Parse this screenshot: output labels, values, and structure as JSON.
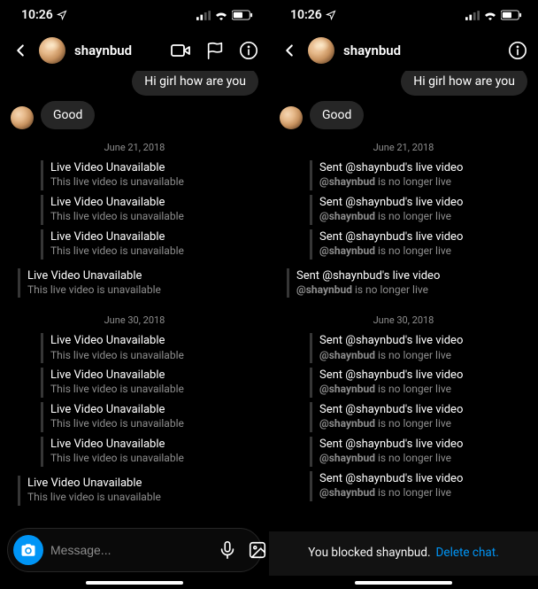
{
  "status": {
    "time": "10:26",
    "send_icon": "location-arrow-icon",
    "signal_icon": "cell-signal-icon",
    "wifi_icon": "wifi-icon",
    "battery_icon": "battery-icon"
  },
  "header": {
    "username": "shaynbud"
  },
  "left": {
    "messages": {
      "out1": "Hi girl how are you",
      "in1": "Good",
      "ts1": "June 21, 2018",
      "ts2": "June 30, 2018",
      "sys_title": "Live Video Unavailable",
      "sys_sub": "This live video is unavailable"
    },
    "composer": {
      "placeholder": "Message..."
    }
  },
  "right": {
    "messages": {
      "out1": "Hi girl how are you",
      "in1": "Good",
      "ts1": "June 21, 2018",
      "ts2": "June 30, 2018",
      "sys_title": "Sent @shaynbud's live video",
      "sys_handle": "@shaynbud",
      "sys_tail": " is no longer live"
    },
    "blocked": {
      "text": "You blocked shaynbud.",
      "link": "Delete chat."
    }
  }
}
